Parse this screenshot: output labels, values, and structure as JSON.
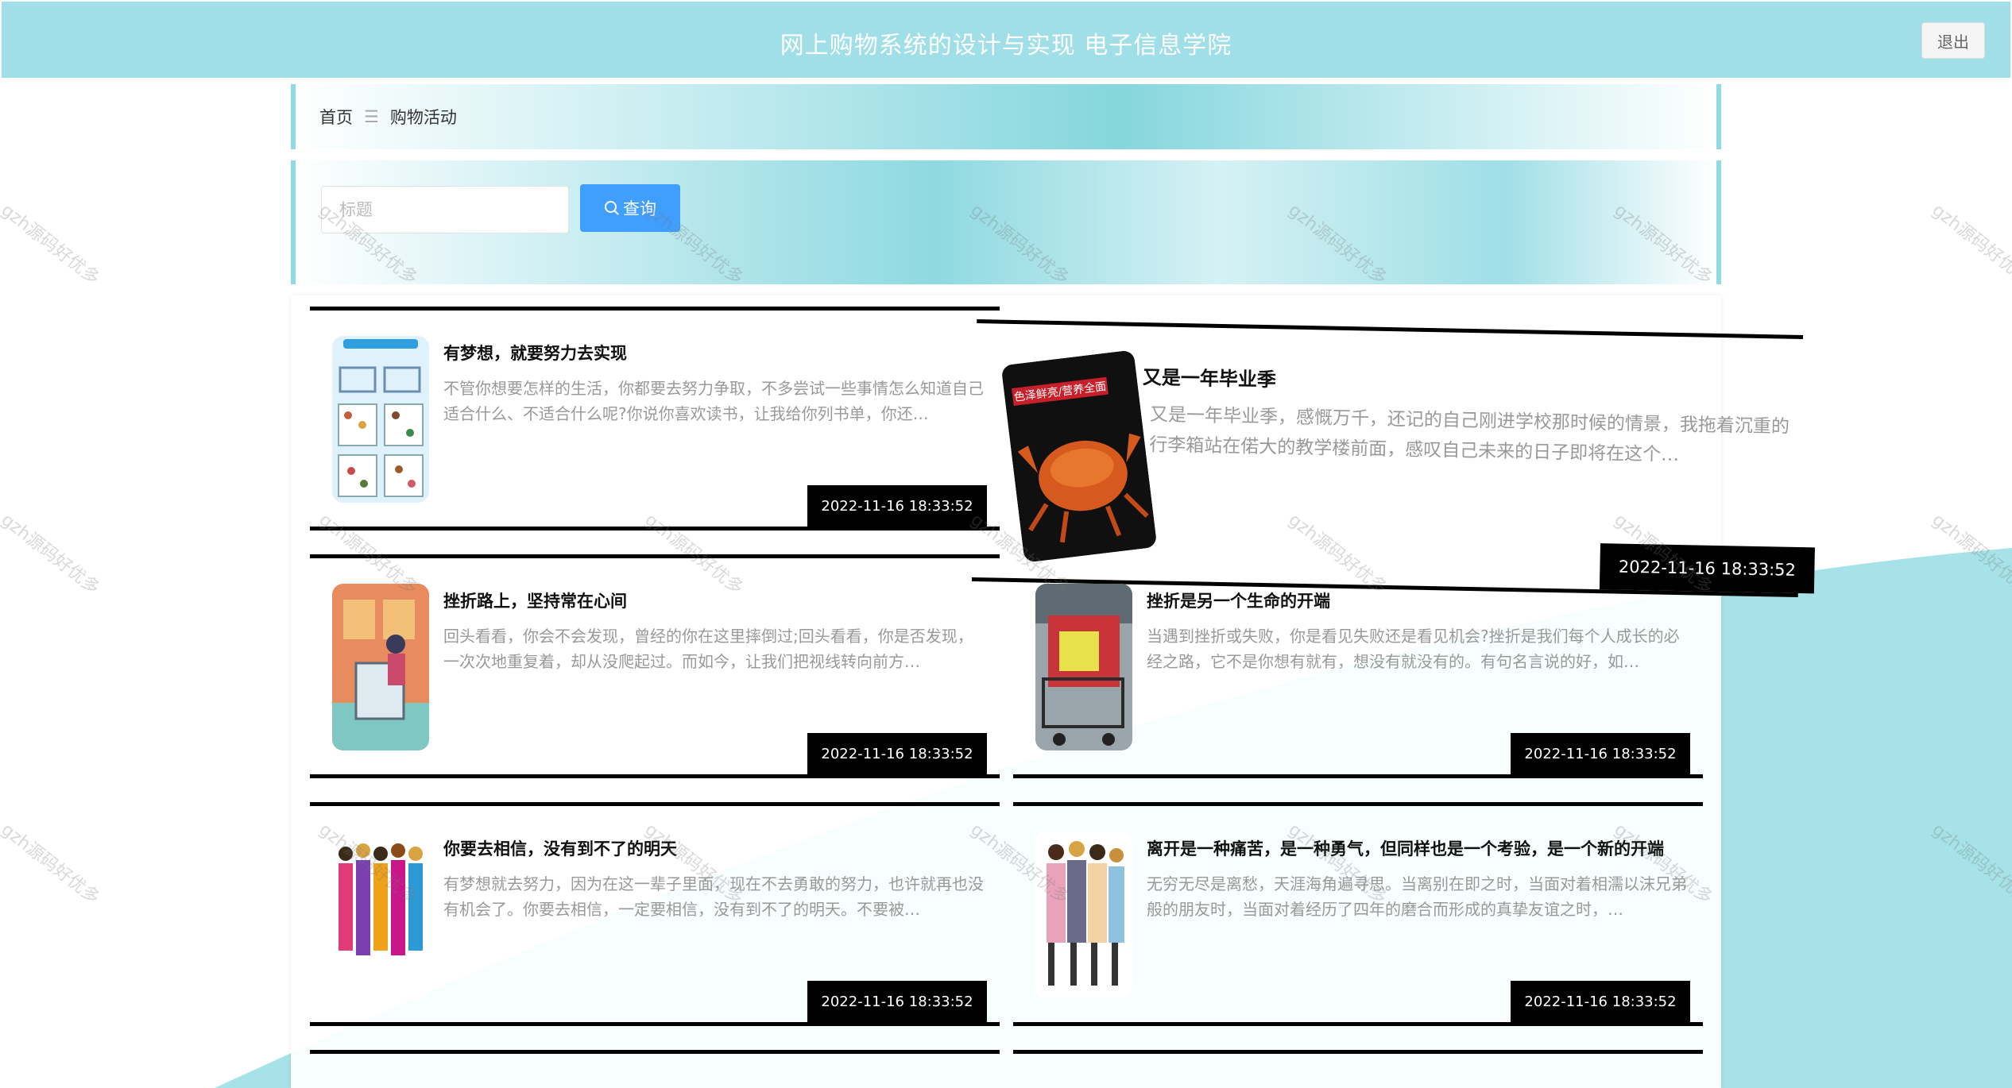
{
  "header": {
    "title": "网上购物系统的设计与实现 电子信息学院",
    "logout_label": "退出"
  },
  "breadcrumb": {
    "home": "首页",
    "separator": "☰",
    "current": "购物活动"
  },
  "search": {
    "placeholder": "标题",
    "value": "",
    "button_label": "查询",
    "button_icon": "search-icon"
  },
  "watermark": "gzh源码好优多",
  "colors": {
    "header_bg": "#a0dfe7",
    "accent_teal": "#90dbe3",
    "button_blue": "#409eff",
    "card_border": "#000000"
  },
  "articles": [
    {
      "title": "有梦想，就要努力去实现",
      "desc": "不管你想要怎样的生活，你都要去努力争取，不多尝试一些事情怎么知道自己适合什么、不适合什么呢?你说你喜欢读书，让我给你列书单，你还…",
      "time": "2022-11-16 18:33:52",
      "image": "shopping-list-illustration"
    },
    {
      "title": "又是一年毕业季",
      "desc": "又是一年毕业季，感慨万千，还记的自己刚进学校那时候的情景，我拖着沉重的行李箱站在偌大的教学楼前面，感叹自己未来的日子即将在这个…",
      "time": "2022-11-16 18:33:52",
      "image": "crab-seafood-photo",
      "image_text": "色泽鲜亮/营养全面"
    },
    {
      "title": "挫折路上，坚持常在心间",
      "desc": "回头看看，你会不会发现，曾经的你在这里摔倒过;回头看看，你是否发现，一次次地重复着，却从没爬起过。而如今，让我们把视线转向前方…",
      "time": "2022-11-16 18:33:52",
      "image": "shopping-cart-girl-illustration"
    },
    {
      "title": "挫折是另一个生命的开端",
      "desc": "当遇到挫折或失败，你是看见失败还是看见机会?挫折是我们每个人成长的必经之路，它不是你想有就有，想没有就没有的。有句名言说的好，如…",
      "time": "2022-11-16 18:33:52",
      "image": "shopping-cart-photo"
    },
    {
      "title": "你要去相信，没有到不了的明天",
      "desc": "有梦想就去努力，因为在这一辈子里面，现在不去勇敢的努力，也许就再也没有机会了。你要去相信，一定要相信，没有到不了的明天。不要被…",
      "time": "2022-11-16 18:33:52",
      "image": "shopping-women-illustration"
    },
    {
      "title": "离开是一种痛苦，是一种勇气，但同样也是一个考验，是一个新的开端",
      "desc": "无穷无尽是离愁，天涯海角遍寻思。当离别在即之时，当面对着相濡以沫兄弟般的朋友时，当面对着经历了四年的磨合而形成的真挚友谊之时，…",
      "time": "2022-11-16 18:33:52",
      "image": "shopping-friends-photo"
    }
  ]
}
